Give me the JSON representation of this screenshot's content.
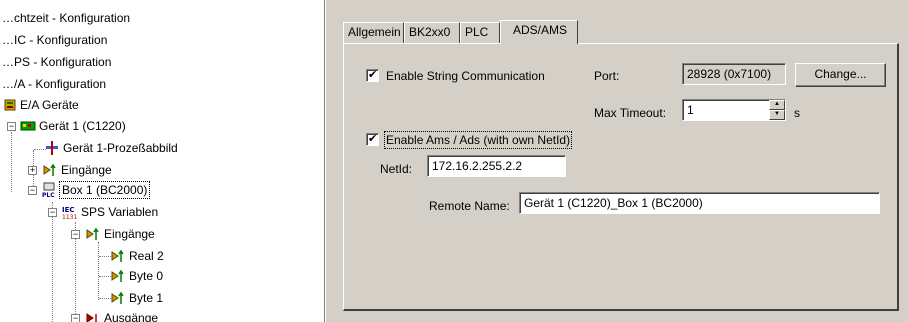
{
  "tree": {
    "items": [
      {
        "label": "…chtzeit - Konfiguration",
        "icon": "realtime-config-icon"
      },
      {
        "label": "…IC - Konfiguration",
        "icon": "nc-config-icon"
      },
      {
        "label": "…PS - Konfiguration",
        "icon": "plc-config-icon"
      },
      {
        "label": "…/A - Konfiguration",
        "icon": "io-config-icon"
      },
      {
        "label": "E/A Geräte",
        "icon": "io-devices-icon"
      },
      {
        "label": "Gerät 1 (C1220)",
        "icon": "device-card-icon",
        "expander": "−"
      },
      {
        "label": "Gerät 1-Prozeßabbild",
        "icon": "process-image-icon"
      },
      {
        "label": "Eingänge",
        "icon": "inputs-icon",
        "expander": "+"
      },
      {
        "label": "Box 1 (BC2000)",
        "icon": "plc-box-icon",
        "expander": "−",
        "selected": true
      },
      {
        "label": "SPS Variablen",
        "icon": "iec-variables-icon",
        "expander": "−"
      },
      {
        "label": "Eingänge",
        "icon": "inputs-icon",
        "expander": "−"
      },
      {
        "label": "Real 2",
        "icon": "input-variable-icon"
      },
      {
        "label": "Byte 0",
        "icon": "input-variable-icon"
      },
      {
        "label": "Byte 1",
        "icon": "input-variable-icon"
      },
      {
        "label": "Ausgänge",
        "icon": "outputs-icon",
        "expander": "−"
      }
    ]
  },
  "tabs": [
    "Allgemein",
    "BK2xx0",
    "PLC",
    "ADS/AMS"
  ],
  "active_tab": "ADS/AMS",
  "form": {
    "enable_string_label": "Enable String Communication",
    "enable_string_checked": true,
    "port_label": "Port:",
    "port_value": "28928 (0x7100)",
    "change_button": "Change...",
    "max_timeout_label": "Max Timeout:",
    "max_timeout_value": "1",
    "max_timeout_unit": "s",
    "enable_ams_label": "Enable Ams / Ads (with own NetId)",
    "enable_ams_checked": true,
    "netid_label": "NetId:",
    "netid_value": "172.16.2.255.2.2",
    "remote_name_label": "Remote Name:",
    "remote_name_value": "Gerät 1 (C1220)_Box 1 (BC2000)"
  },
  "colors": {
    "window_bg": "#d4d0c8",
    "tree_bg": "#ffffff",
    "field_bg": "#ffffff"
  }
}
